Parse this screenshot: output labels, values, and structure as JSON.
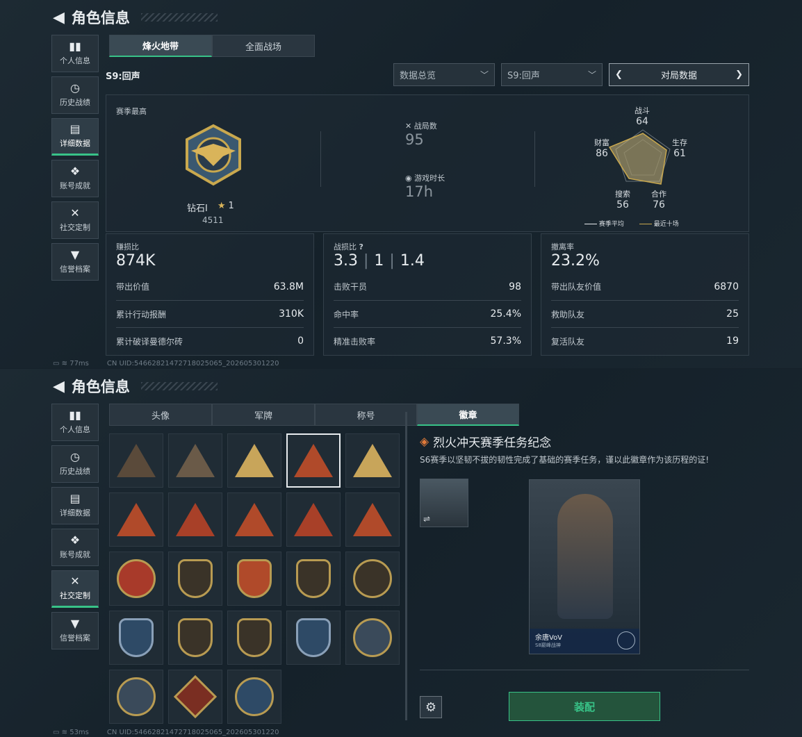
{
  "top": {
    "title": "角色信息",
    "nav": [
      {
        "label": "个人信息",
        "icon": "bar-chart-icon"
      },
      {
        "label": "历史战绩",
        "icon": "clock-icon"
      },
      {
        "label": "详细数据",
        "icon": "stack-icon"
      },
      {
        "label": "账号成就",
        "icon": "achievement-icon"
      },
      {
        "label": "社交定制",
        "icon": "tools-icon"
      },
      {
        "label": "信誉档案",
        "icon": "gem-icon"
      }
    ],
    "active_nav": "详细数据",
    "tabs": [
      "烽火地带",
      "全面战场"
    ],
    "season": "S9:回声",
    "dropdowns": {
      "overview": "数据总览",
      "season": "S9:回声",
      "pager": "对局数据"
    },
    "season_best": {
      "label": "赛季最高",
      "rank": "钻石Ⅰ",
      "stars": "1",
      "score": "4511"
    },
    "matches": {
      "label": "战局数",
      "value": "95"
    },
    "playtime": {
      "label": "游戏时长",
      "value": "17h"
    },
    "radar": {
      "axes": [
        {
          "name": "战斗",
          "value": "64"
        },
        {
          "name": "生存",
          "value": "61"
        },
        {
          "name": "合作",
          "value": "76"
        },
        {
          "name": "搜索",
          "value": "56"
        },
        {
          "name": "财富",
          "value": "86"
        }
      ],
      "legend": [
        "赛季平均",
        "最近十场"
      ]
    },
    "cards": [
      {
        "title": "赚损比",
        "big": "874K",
        "rows": [
          [
            "带出价值",
            "63.8M"
          ],
          [
            "累计行动报酬",
            "310K"
          ],
          [
            "累计破译曼德尔砖",
            "0"
          ]
        ]
      },
      {
        "title": "战损比",
        "big": "3.3",
        "big2": "1",
        "big3": "1.4",
        "rows": [
          [
            "击败干员",
            "98"
          ],
          [
            "命中率",
            "25.4%"
          ],
          [
            "精准击败率",
            "57.3%"
          ]
        ]
      },
      {
        "title": "撤离率",
        "big": "23.2%",
        "rows": [
          [
            "带出队友价值",
            "6870"
          ],
          [
            "救助队友",
            "25"
          ],
          [
            "复活队友",
            "19"
          ]
        ]
      }
    ],
    "ping": "77ms",
    "uid": "CN UID:546628214727180250​65_202605301220"
  },
  "bottom": {
    "title": "角色信息",
    "active_nav": "社交定制",
    "tabs": [
      "头像",
      "军牌",
      "称号",
      "徽章"
    ],
    "active_tab": "徽章",
    "badge_title": "烈火冲天赛季任务纪念",
    "badge_desc": "S6赛季以坚韧不拔的韧性完成了基础的赛季任务，谨以此徽章作为该历程的证!",
    "card_name": "余唐VoV",
    "card_sub": "S8巅峰战神",
    "equip": "装配",
    "ping": "53ms",
    "uid": "CN UID:546628214727180250​65_202605301220"
  }
}
